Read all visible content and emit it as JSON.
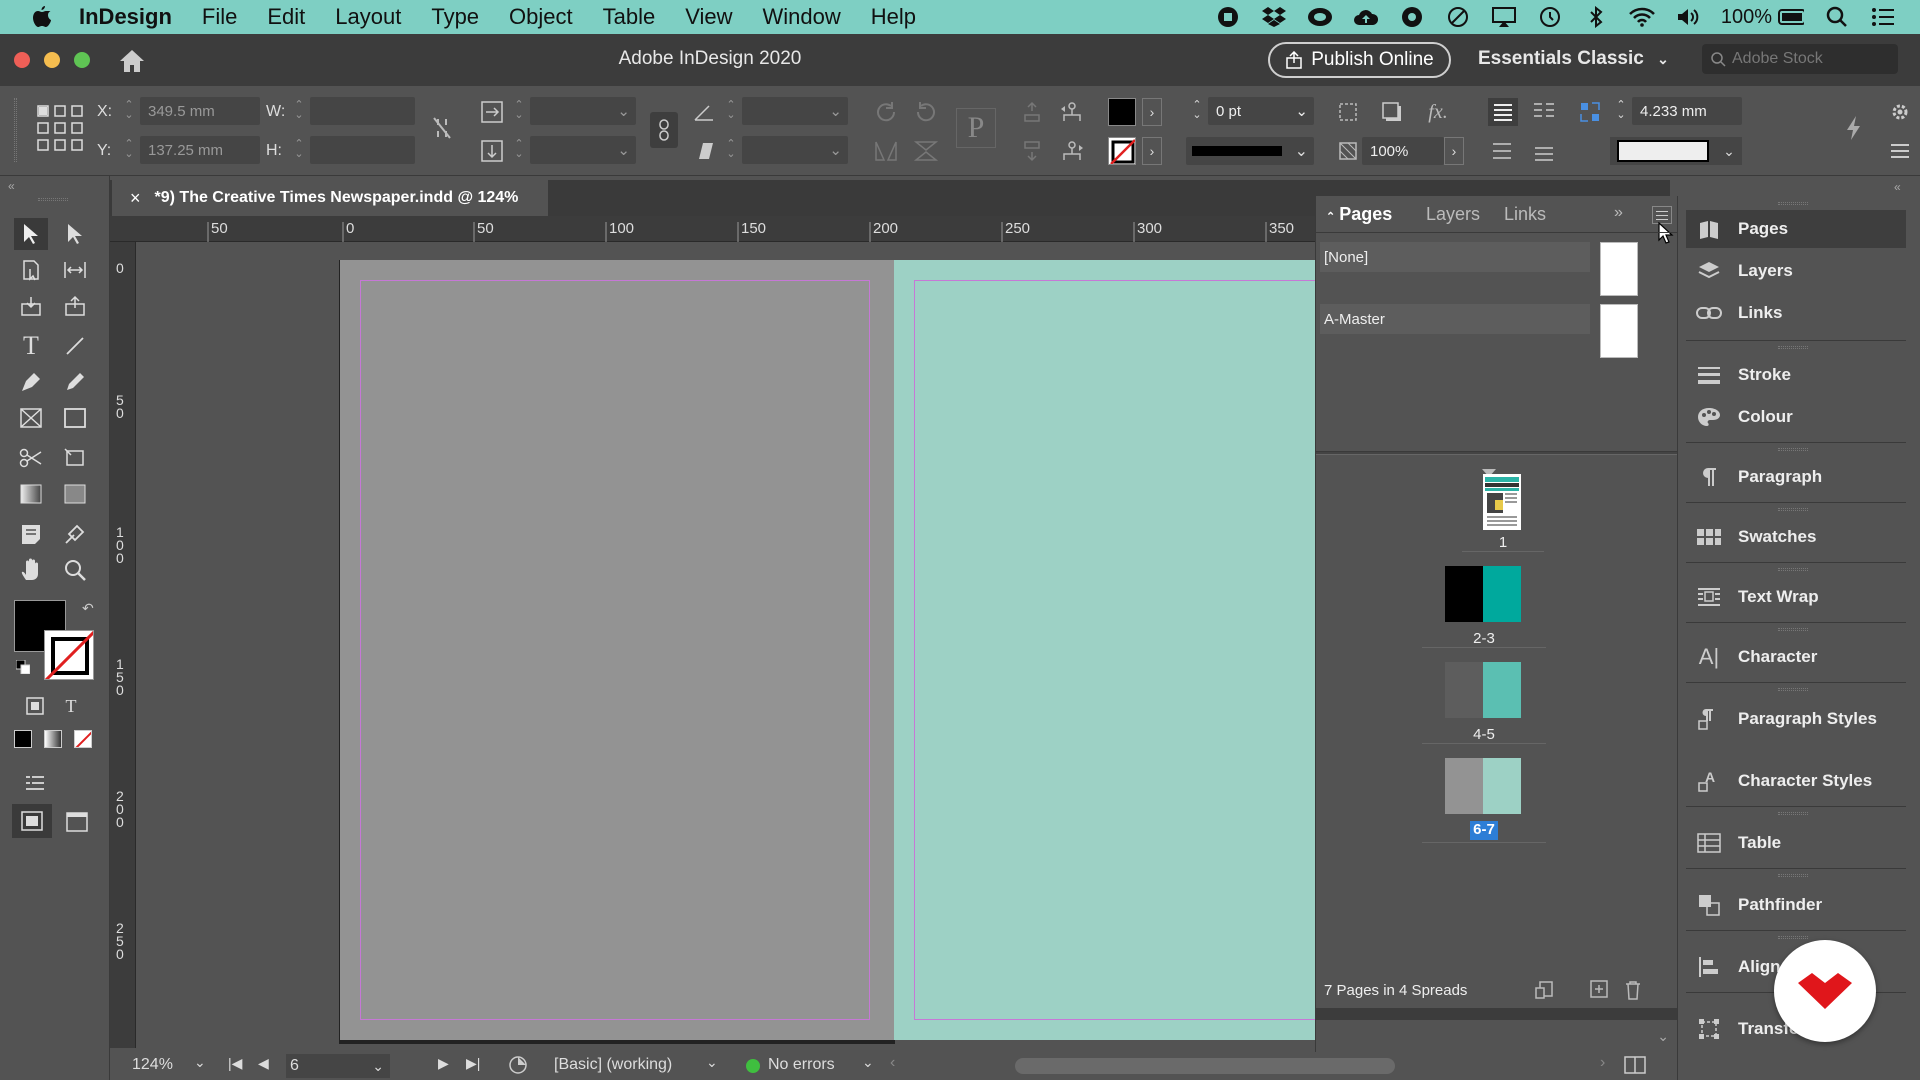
{
  "menubar": {
    "app": "InDesign",
    "items": [
      "File",
      "Edit",
      "Layout",
      "Type",
      "Object",
      "Table",
      "View",
      "Window",
      "Help"
    ],
    "battery": "100%"
  },
  "window": {
    "title": "Adobe InDesign 2020",
    "publish_label": "Publish Online",
    "workspace": "Essentials Classic",
    "stock_placeholder": "Adobe Stock"
  },
  "control": {
    "x_label": "X:",
    "x_value": "349.5 mm",
    "y_label": "Y:",
    "y_value": "137.25 mm",
    "w_label": "W:",
    "h_label": "H:",
    "stroke_weight": "0 pt",
    "opacity": "100%",
    "gap": "4.233 mm"
  },
  "document": {
    "tab_label": "*9) The Creative Times Newspaper.indd @ 124%"
  },
  "ruler": {
    "h_ticks": [
      "50",
      "0",
      "50",
      "100",
      "150",
      "200",
      "250",
      "300",
      "350"
    ],
    "v_ticks": [
      "0",
      "50",
      "100",
      "150",
      "200",
      "250"
    ]
  },
  "pages_panel": {
    "tabs": [
      "Pages",
      "Layers",
      "Links"
    ],
    "masters": [
      "[None]",
      "A-Master"
    ],
    "spreads": [
      {
        "label": "1"
      },
      {
        "label": "2-3"
      },
      {
        "label": "4-5"
      },
      {
        "label": "6-7",
        "selected": true
      }
    ],
    "footer": "7 Pages in 4 Spreads"
  },
  "dock": {
    "items": [
      "Pages",
      "Layers",
      "Links",
      "Stroke",
      "Colour",
      "Paragraph",
      "Swatches",
      "Text Wrap",
      "Character",
      "Paragraph Styles",
      "Character Styles",
      "Table",
      "Pathfinder",
      "Align",
      "Transform"
    ]
  },
  "status": {
    "zoom": "124%",
    "page": "6",
    "profile": "[Basic] (working)",
    "errors": "No errors"
  },
  "colors": {
    "teal": "#00a99d",
    "teal_light": "#9dd1c5",
    "selection": "#2d7ed6"
  }
}
